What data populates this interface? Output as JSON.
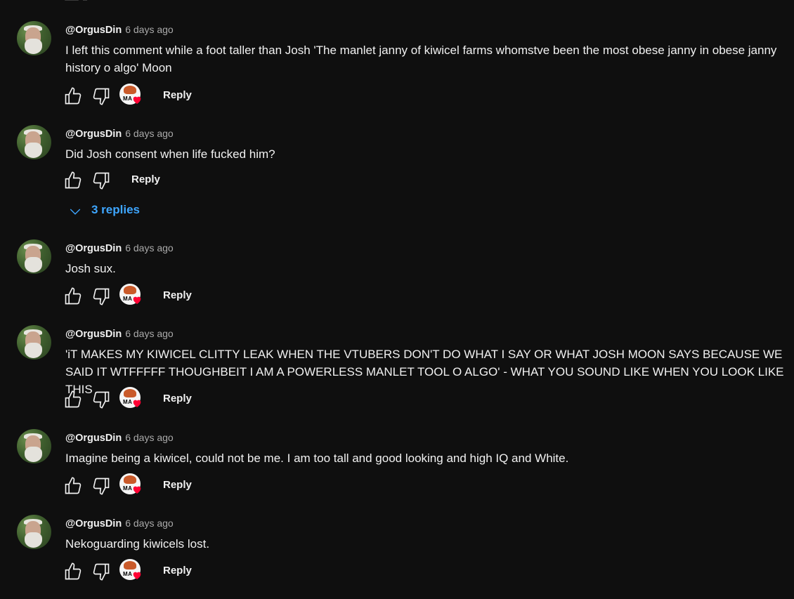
{
  "comments": [
    {
      "author": "@OrgusDin",
      "time": "6 days ago",
      "text": "I left this comment while a foot taller than Josh 'The manlet janny of kiwicel farms whomstve been the most obese janny in obese janny history o algo' Moon",
      "reply_label": "Reply",
      "creator_heart": true
    },
    {
      "author": "@OrgusDin",
      "time": "6 days ago",
      "text": "Did Josh consent when life fucked him?",
      "reply_label": "Reply",
      "creator_heart": false,
      "replies_label": "3 replies"
    },
    {
      "author": "@OrgusDin",
      "time": "6 days ago",
      "text": "Josh sux.",
      "reply_label": "Reply",
      "creator_heart": true
    },
    {
      "author": "@OrgusDin",
      "time": "6 days ago",
      "text": "'iT MAKES MY KIWICEL CLITTY LEAK WHEN THE VTUBERS DON'T DO WHAT I SAY OR WHAT JOSH MOON SAYS BECAUSE WE SAID IT WTFFFFF THOUGHBEIT I AM A POWERLESS MANLET TOOL O ALGO' - WHAT YOU SOUND LIKE WHEN YOU LOOK LIKE THIS",
      "reply_label": "Reply",
      "creator_heart": true
    },
    {
      "author": "@OrgusDin",
      "time": "6 days ago",
      "text": "Imagine being a kiwicel, could not be me. I am too tall and good looking and high IQ and White.",
      "reply_label": "Reply",
      "creator_heart": true
    },
    {
      "author": "@OrgusDin",
      "time": "6 days ago",
      "text": "Nekoguarding kiwicels lost.",
      "reply_label": "Reply",
      "creator_heart": true
    }
  ],
  "creator_badge_text": "MA",
  "colors": {
    "background": "#0f0f0f",
    "text": "#f1f1f1",
    "meta": "#aaaaaa",
    "link": "#3ea6ff",
    "heart": "#ff0033"
  }
}
